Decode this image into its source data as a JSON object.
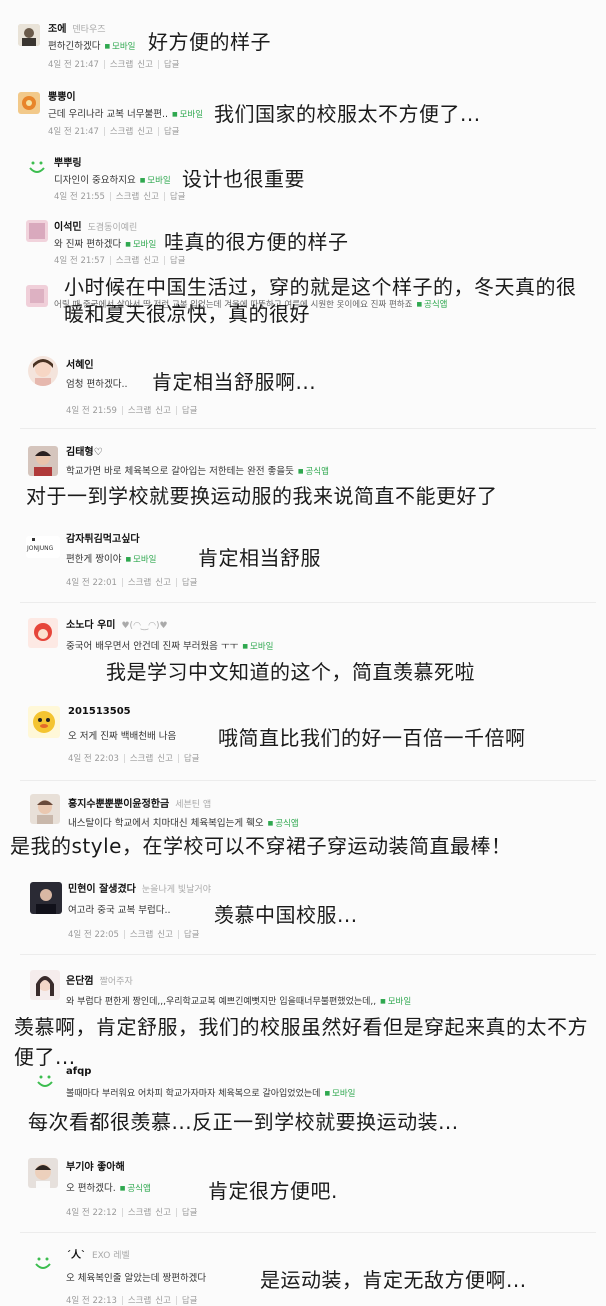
{
  "colors": {
    "badge": "#2fa84f",
    "meta": "#9a9a9a",
    "text": "#1a1a1a"
  },
  "comments": [
    {
      "avatar": "person",
      "name": "조에",
      "sub": "덴타우즈",
      "text": "편하긴하겠다",
      "badge": "모바일",
      "time": "4일 전 21:47",
      "actions": [
        "스크랩",
        "신고",
        "답글"
      ],
      "translation": "好方便的样子"
    },
    {
      "avatar": "orange",
      "name": "뿡뿡이",
      "sub": "",
      "text": "근데 우리나라 교복 너무불편..",
      "badge": "모바일",
      "time": "4일 전 21:47",
      "actions": [
        "스크랩",
        "신고",
        "답글"
      ],
      "translation": "我们国家的校服太不方便了..."
    },
    {
      "avatar": "smile",
      "name": "뿌뿌링",
      "sub": "",
      "text": "디자인이 중요하지요",
      "badge": "모바일",
      "time": "4일 전 21:55",
      "actions": [
        "스크랩",
        "신고",
        "답글"
      ],
      "translation": "设计也很重要"
    },
    {
      "avatar": "pink",
      "name": "이석민",
      "sub": "도겸동이예린",
      "text": "와 진짜 편하겠다",
      "badge": "모바일",
      "time": "4일 전 21:57",
      "actions": [
        "스크랩",
        "신고",
        "답글"
      ],
      "translation": "哇真的很方便的样子"
    },
    {
      "avatar": "pink2",
      "name": "",
      "sub": "",
      "text": "어릴 때 중국에서 살아서 딱 저런 교복 입었는데 겨울에 따뜻하고 여름에 시원한 옷이에요 진짜 편하죠",
      "badge": "공식앱",
      "time": "",
      "actions": [],
      "translation": "小时候在中国生活过，穿的就是这个样子的，冬天真的很暖和夏天很凉快，真的很好"
    },
    {
      "avatar": "girl",
      "name": "서혜인",
      "sub": "",
      "text": "엄청 편하겠다..",
      "badge": "",
      "time": "4일 전 21:59",
      "actions": [
        "스크랩",
        "신고",
        "답글"
      ],
      "translation": "肯定相当舒服啊..."
    },
    {
      "avatar": "boy",
      "name": "김태형♡",
      "sub": "",
      "text": "학교가면 바로 체육복으로 갈아입는 저한테는 완전 좋을듯",
      "badge": "공식앱",
      "time": "",
      "actions": [],
      "translation": "对于一到学校就要换运动服的我来说简直不能更好了"
    },
    {
      "avatar": "jonjung",
      "name": "감자튀김먹고싶다",
      "sub": "",
      "text": "편한게 짱이야",
      "badge": "모바일",
      "time": "4일 전 22:01",
      "actions": [
        "스크랩",
        "신고",
        "답글"
      ],
      "translation": "肯定相当舒服"
    },
    {
      "avatar": "red",
      "name": "소노다 우미",
      "sub": "♥(◠‿◠)♥",
      "text": "중국어 배우면서 안건데 진짜 부러웠음 ㅜㅜ",
      "badge": "모바일",
      "time": "",
      "actions": [],
      "translation": "我是学习中文知道的这个，简直羡慕死啦"
    },
    {
      "avatar": "yellow",
      "name": "201513505",
      "sub": "",
      "text": "오 저게 진짜 백배천배 나음",
      "badge": "",
      "time": "4일 전 22:03",
      "actions": [
        "스크랩",
        "신고",
        "답글"
      ],
      "translation": "哦简直比我们的好一百倍一千倍啊"
    },
    {
      "avatar": "boy2",
      "name": "홍지수뿐뿐뿐이윤정한금",
      "sub": "세븐틴 앱",
      "text": "내스탈이다 학교에서 치마대신 체육복입는게 훽오",
      "badge": "공식앱",
      "time": "",
      "actions": [],
      "translation": "是我的style，在学校可以不穿裙子穿运动装简直最棒！"
    },
    {
      "avatar": "dark",
      "name": "민현이 잘생겼다",
      "sub": "눈을나게 빛날거야",
      "text": "여고라 중국 교복 부럽다..",
      "badge": "",
      "time": "4일 전 22:05",
      "actions": [
        "스크랩",
        "신고",
        "답글"
      ],
      "translation": "羡慕中国校服..."
    },
    {
      "avatar": "girl2",
      "name": "은단껌",
      "sub": "짤어주자",
      "text": "와 부럽다 편한게 짱인데,,,우리학교교복 예쁘긴예뻣지만 입을때너무불편했었는데,,",
      "badge": "모바일",
      "time": "",
      "actions": [],
      "translation": "羡慕啊，肯定舒服，我们的校服虽然好看但是穿起来真的太不方便了..."
    },
    {
      "avatar": "smile",
      "name": "afqp",
      "sub": "",
      "text": "볼때마다 부러워요 어차피 학교가자마자 체육복으로 갈아입었었는데",
      "badge": "모바일",
      "time": "",
      "actions": [],
      "translation": "每次看都很羡慕...反正一到学校就要换运动装..."
    },
    {
      "avatar": "boy3",
      "name": "부기야 좋아해",
      "sub": "",
      "text": "오 편하겠다.",
      "badge": "공식앱",
      "time": "4일 전 22:12",
      "actions": [
        "스크랩",
        "신고",
        "답글"
      ],
      "translation": "肯定很方便吧."
    },
    {
      "avatar": "smile",
      "name": "´人`",
      "sub": "EXO 레벨",
      "text": "오 체육복인줄 알았는데 짱편하겠다",
      "badge": "",
      "time": "4일 전 22:13",
      "actions": [
        "스크랩",
        "신고",
        "답글"
      ],
      "translation": "是运动装，肯定无敌方便啊..."
    }
  ]
}
